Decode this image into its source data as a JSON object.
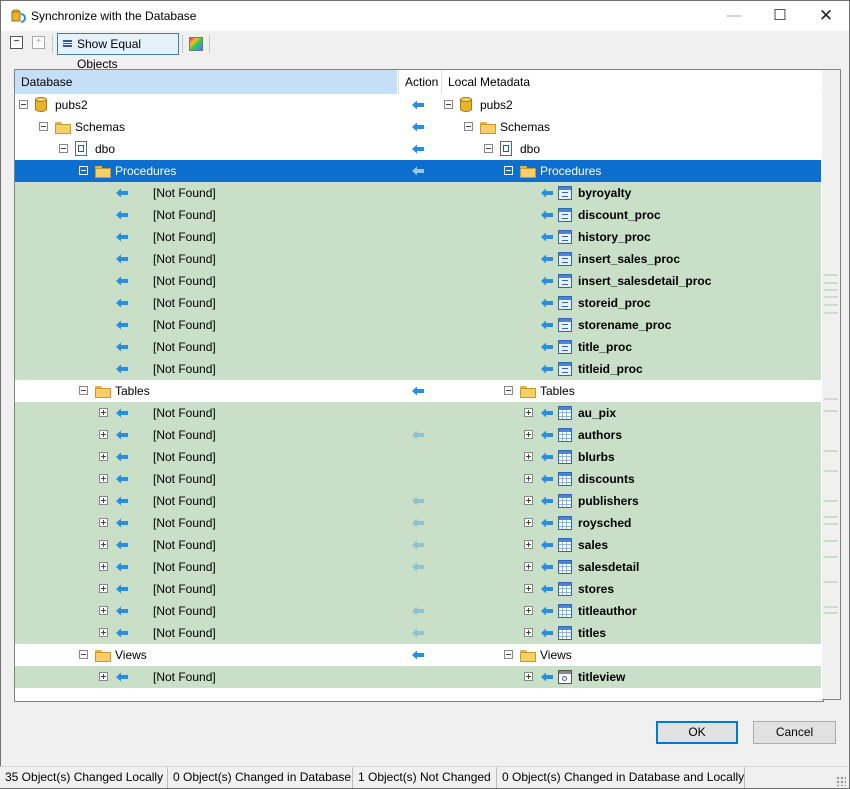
{
  "window": {
    "title": "Synchronize with the Database",
    "controls": {
      "minimize": "—",
      "maximize": "☐",
      "close": "✕"
    }
  },
  "toolbar": {
    "collapse_label": "−",
    "expand_label": "+",
    "show_equal_label": "Show Equal Objects"
  },
  "grid": {
    "columns": {
      "database": "Database",
      "action": "Action",
      "local": "Local Metadata"
    },
    "rows": [
      {
        "style": "w",
        "left": {
          "label": "pubs2",
          "icon": "database",
          "indent": 0,
          "exp": "minus"
        },
        "action": "left",
        "right": {
          "label": "pubs2",
          "icon": "database",
          "indent": 0,
          "exp": "minus"
        }
      },
      {
        "style": "w",
        "left": {
          "label": "Schemas",
          "icon": "folder",
          "indent": 1,
          "exp": "minus"
        },
        "action": "left",
        "right": {
          "label": "Schemas",
          "icon": "folder",
          "indent": 1,
          "exp": "minus"
        }
      },
      {
        "style": "w",
        "left": {
          "label": "dbo",
          "icon": "schema",
          "indent": 2,
          "exp": "minus"
        },
        "action": "left",
        "right": {
          "label": "dbo",
          "icon": "schema",
          "indent": 2,
          "exp": "minus"
        }
      },
      {
        "style": "sel",
        "left": {
          "label": "Procedures",
          "icon": "folder",
          "indent": 3,
          "exp": "minus"
        },
        "action": "left-faint",
        "right": {
          "label": "Procedures",
          "icon": "folder",
          "indent": 3,
          "exp": "minus"
        }
      },
      {
        "style": "g",
        "left": {
          "label": "[Not Found]",
          "arrow": true,
          "indent": 4
        },
        "action": "",
        "right": {
          "label": "byroyalty",
          "icon": "proc",
          "arrow": true,
          "indent": 4,
          "bold": true
        }
      },
      {
        "style": "g",
        "left": {
          "label": "[Not Found]",
          "arrow": true,
          "indent": 4
        },
        "action": "",
        "right": {
          "label": "discount_proc",
          "icon": "proc",
          "arrow": true,
          "indent": 4,
          "bold": true
        }
      },
      {
        "style": "g",
        "left": {
          "label": "[Not Found]",
          "arrow": true,
          "indent": 4
        },
        "action": "",
        "right": {
          "label": "history_proc",
          "icon": "proc",
          "arrow": true,
          "indent": 4,
          "bold": true
        }
      },
      {
        "style": "g",
        "left": {
          "label": "[Not Found]",
          "arrow": true,
          "indent": 4
        },
        "action": "",
        "right": {
          "label": "insert_sales_proc",
          "icon": "proc",
          "arrow": true,
          "indent": 4,
          "bold": true
        }
      },
      {
        "style": "g",
        "left": {
          "label": "[Not Found]",
          "arrow": true,
          "indent": 4
        },
        "action": "",
        "right": {
          "label": "insert_salesdetail_proc",
          "icon": "proc",
          "arrow": true,
          "indent": 4,
          "bold": true
        }
      },
      {
        "style": "g",
        "left": {
          "label": "[Not Found]",
          "arrow": true,
          "indent": 4
        },
        "action": "",
        "right": {
          "label": "storeid_proc",
          "icon": "proc",
          "arrow": true,
          "indent": 4,
          "bold": true
        }
      },
      {
        "style": "g",
        "left": {
          "label": "[Not Found]",
          "arrow": true,
          "indent": 4
        },
        "action": "",
        "right": {
          "label": "storename_proc",
          "icon": "proc",
          "arrow": true,
          "indent": 4,
          "bold": true
        }
      },
      {
        "style": "g",
        "left": {
          "label": "[Not Found]",
          "arrow": true,
          "indent": 4
        },
        "action": "",
        "right": {
          "label": "title_proc",
          "icon": "proc",
          "arrow": true,
          "indent": 4,
          "bold": true
        }
      },
      {
        "style": "g",
        "left": {
          "label": "[Not Found]",
          "arrow": true,
          "indent": 4
        },
        "action": "",
        "right": {
          "label": "titleid_proc",
          "icon": "proc",
          "arrow": true,
          "indent": 4,
          "bold": true
        }
      },
      {
        "style": "w",
        "left": {
          "label": "Tables",
          "icon": "folder",
          "indent": 3,
          "exp": "minus"
        },
        "action": "left",
        "right": {
          "label": "Tables",
          "icon": "folder",
          "indent": 3,
          "exp": "minus"
        }
      },
      {
        "style": "g",
        "left": {
          "label": "[Not Found]",
          "arrow": true,
          "indent": 4,
          "exp": "plus"
        },
        "action": "",
        "right": {
          "label": "au_pix",
          "icon": "table",
          "arrow": true,
          "indent": 4,
          "bold": true,
          "exp": "plus"
        }
      },
      {
        "style": "g",
        "left": {
          "label": "[Not Found]",
          "arrow": true,
          "indent": 4,
          "exp": "plus"
        },
        "action": "left-faint",
        "right": {
          "label": "authors",
          "icon": "table",
          "arrow": true,
          "indent": 4,
          "bold": true,
          "exp": "plus"
        }
      },
      {
        "style": "g",
        "left": {
          "label": "[Not Found]",
          "arrow": true,
          "indent": 4,
          "exp": "plus"
        },
        "action": "",
        "right": {
          "label": "blurbs",
          "icon": "table",
          "arrow": true,
          "indent": 4,
          "bold": true,
          "exp": "plus"
        }
      },
      {
        "style": "g",
        "left": {
          "label": "[Not Found]",
          "arrow": true,
          "indent": 4,
          "exp": "plus"
        },
        "action": "",
        "right": {
          "label": "discounts",
          "icon": "table",
          "arrow": true,
          "indent": 4,
          "bold": true,
          "exp": "plus"
        }
      },
      {
        "style": "g",
        "left": {
          "label": "[Not Found]",
          "arrow": true,
          "indent": 4,
          "exp": "plus"
        },
        "action": "left-faint",
        "right": {
          "label": "publishers",
          "icon": "table",
          "arrow": true,
          "indent": 4,
          "bold": true,
          "exp": "plus"
        }
      },
      {
        "style": "g",
        "left": {
          "label": "[Not Found]",
          "arrow": true,
          "indent": 4,
          "exp": "plus"
        },
        "action": "left-faint",
        "right": {
          "label": "roysched",
          "icon": "table",
          "arrow": true,
          "indent": 4,
          "bold": true,
          "exp": "plus"
        }
      },
      {
        "style": "g",
        "left": {
          "label": "[Not Found]",
          "arrow": true,
          "indent": 4,
          "exp": "plus"
        },
        "action": "left-faint",
        "right": {
          "label": "sales",
          "icon": "table",
          "arrow": true,
          "indent": 4,
          "bold": true,
          "exp": "plus"
        }
      },
      {
        "style": "g",
        "left": {
          "label": "[Not Found]",
          "arrow": true,
          "indent": 4,
          "exp": "plus"
        },
        "action": "left-faint",
        "right": {
          "label": "salesdetail",
          "icon": "table",
          "arrow": true,
          "indent": 4,
          "bold": true,
          "exp": "plus"
        }
      },
      {
        "style": "g",
        "left": {
          "label": "[Not Found]",
          "arrow": true,
          "indent": 4,
          "exp": "plus"
        },
        "action": "",
        "right": {
          "label": "stores",
          "icon": "table",
          "arrow": true,
          "indent": 4,
          "bold": true,
          "exp": "plus"
        }
      },
      {
        "style": "g",
        "left": {
          "label": "[Not Found]",
          "arrow": true,
          "indent": 4,
          "exp": "plus"
        },
        "action": "left-faint",
        "right": {
          "label": "titleauthor",
          "icon": "table",
          "arrow": true,
          "indent": 4,
          "bold": true,
          "exp": "plus"
        }
      },
      {
        "style": "g",
        "left": {
          "label": "[Not Found]",
          "arrow": true,
          "indent": 4,
          "exp": "plus"
        },
        "action": "left-faint",
        "right": {
          "label": "titles",
          "icon": "table",
          "arrow": true,
          "indent": 4,
          "bold": true,
          "exp": "plus"
        }
      },
      {
        "style": "w",
        "left": {
          "label": "Views",
          "icon": "folder",
          "indent": 3,
          "exp": "minus"
        },
        "action": "left",
        "right": {
          "label": "Views",
          "icon": "folder",
          "indent": 3,
          "exp": "minus"
        }
      },
      {
        "style": "g",
        "left": {
          "label": "[Not Found]",
          "arrow": true,
          "indent": 4,
          "exp": "plus"
        },
        "action": "",
        "right": {
          "label": "titleview",
          "icon": "view",
          "arrow": true,
          "indent": 4,
          "bold": true,
          "exp": "plus"
        }
      }
    ]
  },
  "buttons": {
    "ok": "OK",
    "cancel": "Cancel"
  },
  "status": [
    "35 Object(s) Changed Locally",
    "0 Object(s) Changed in Database",
    "1 Object(s) Not Changed",
    "0 Object(s) Changed in Database and Locally"
  ],
  "colors": {
    "selected_row": "#0c6fd0",
    "changed_row": "#c9dfc8",
    "arrow": "#2a8de0",
    "header_active": "#c5dff7"
  }
}
